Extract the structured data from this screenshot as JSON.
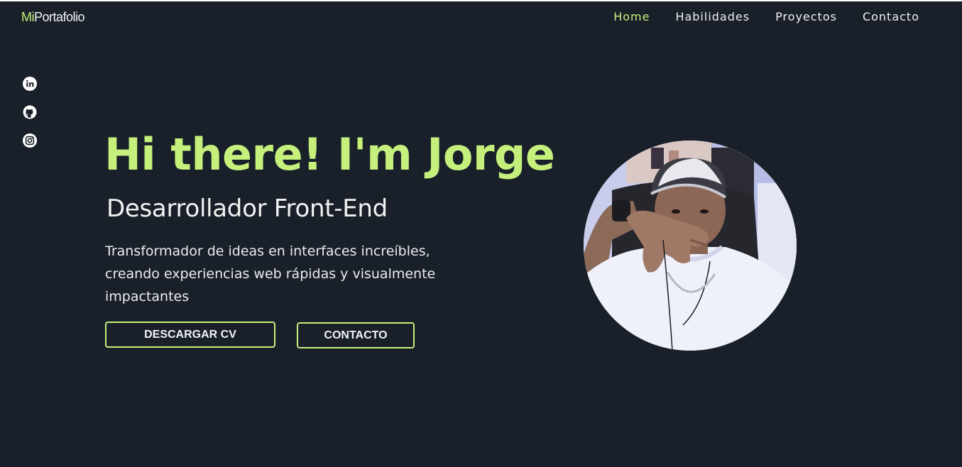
{
  "header": {
    "logo_prefix": "Mi",
    "logo_rest": "Portafolio",
    "nav": [
      {
        "label": "Home",
        "active": true
      },
      {
        "label": "Habilidades",
        "active": false
      },
      {
        "label": "Proyectos",
        "active": false
      },
      {
        "label": "Contacto",
        "active": false
      }
    ]
  },
  "social": [
    {
      "icon": "linkedin-icon"
    },
    {
      "icon": "github-icon"
    },
    {
      "icon": "instagram-icon"
    }
  ],
  "hero": {
    "title": "Hi there! I'm Jorge",
    "subtitle": "Desarrollador Front-End",
    "description": "Transformador de ideas en interfaces increíbles, creando experiencias web rápidas y visualmente impactantes",
    "buttons": {
      "cv_label": "DESCARGAR CV",
      "contact_label": "CONTACTO"
    }
  },
  "colors": {
    "background": "#19202a",
    "accent": "#c6f07c",
    "text": "#f2f2f2"
  }
}
